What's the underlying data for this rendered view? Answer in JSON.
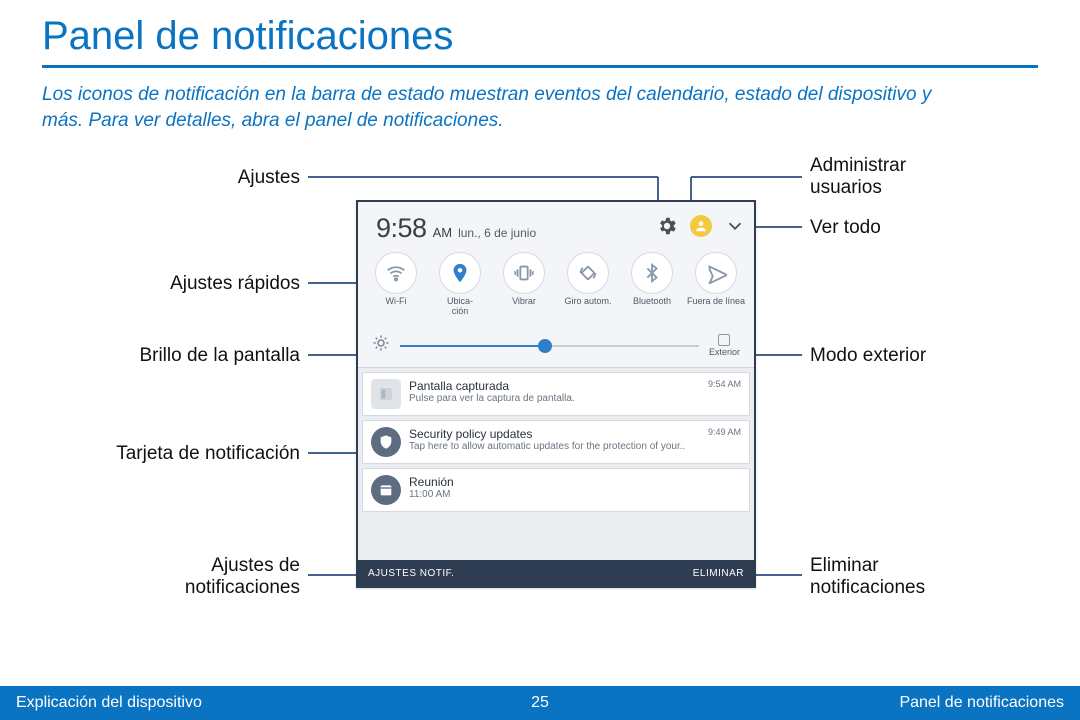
{
  "page": {
    "title": "Panel de notificaciones",
    "intro": "Los iconos de notificación en la barra de estado muestran eventos del calendario, estado del dispositivo y más. Para ver detalles, abra el panel de notificaciones."
  },
  "panel": {
    "clock_time": "9:58",
    "clock_ampm": "AM",
    "clock_date": "lun., 6 de junio",
    "quick_settings": {
      "wifi": "Wi-Fi",
      "location": "Ubica-\nción",
      "vibrate": "Vibrar",
      "autorotate": "Giro autom.",
      "bluetooth": "Bluetooth",
      "airplane": "Fuera de línea"
    },
    "outdoor_label": "Exterior",
    "notifications": {
      "n1": {
        "title": "Pantalla capturada",
        "sub": "Pulse para ver la captura de pantalla.",
        "time": "9:54 AM"
      },
      "n2": {
        "title": "Security policy updates",
        "sub": "Tap here to allow automatic updates for the protection of your..",
        "time": "9:49 AM"
      },
      "n3": {
        "title": "Reunión",
        "sub": "11:00 AM"
      }
    },
    "bottom_left": "AJUSTES NOTIF.",
    "bottom_right": "ELIMINAR"
  },
  "callouts": {
    "ajustes": "Ajustes",
    "admin_usuarios_l1": "Administrar",
    "admin_usuarios_l2": "usuarios",
    "ver_todo": "Ver todo",
    "ajustes_rapidos": "Ajustes rápidos",
    "brillo": "Brillo de la pantalla",
    "modo_exterior": "Modo exterior",
    "tarjeta": "Tarjeta de notificación",
    "ajustes_notif_l1": "Ajustes de",
    "ajustes_notif_l2": "notificaciones",
    "eliminar_l1": "Eliminar",
    "eliminar_l2": "notificaciones"
  },
  "footer": {
    "left": "Explicación del dispositivo",
    "center": "25",
    "right": "Panel de notificaciones"
  }
}
